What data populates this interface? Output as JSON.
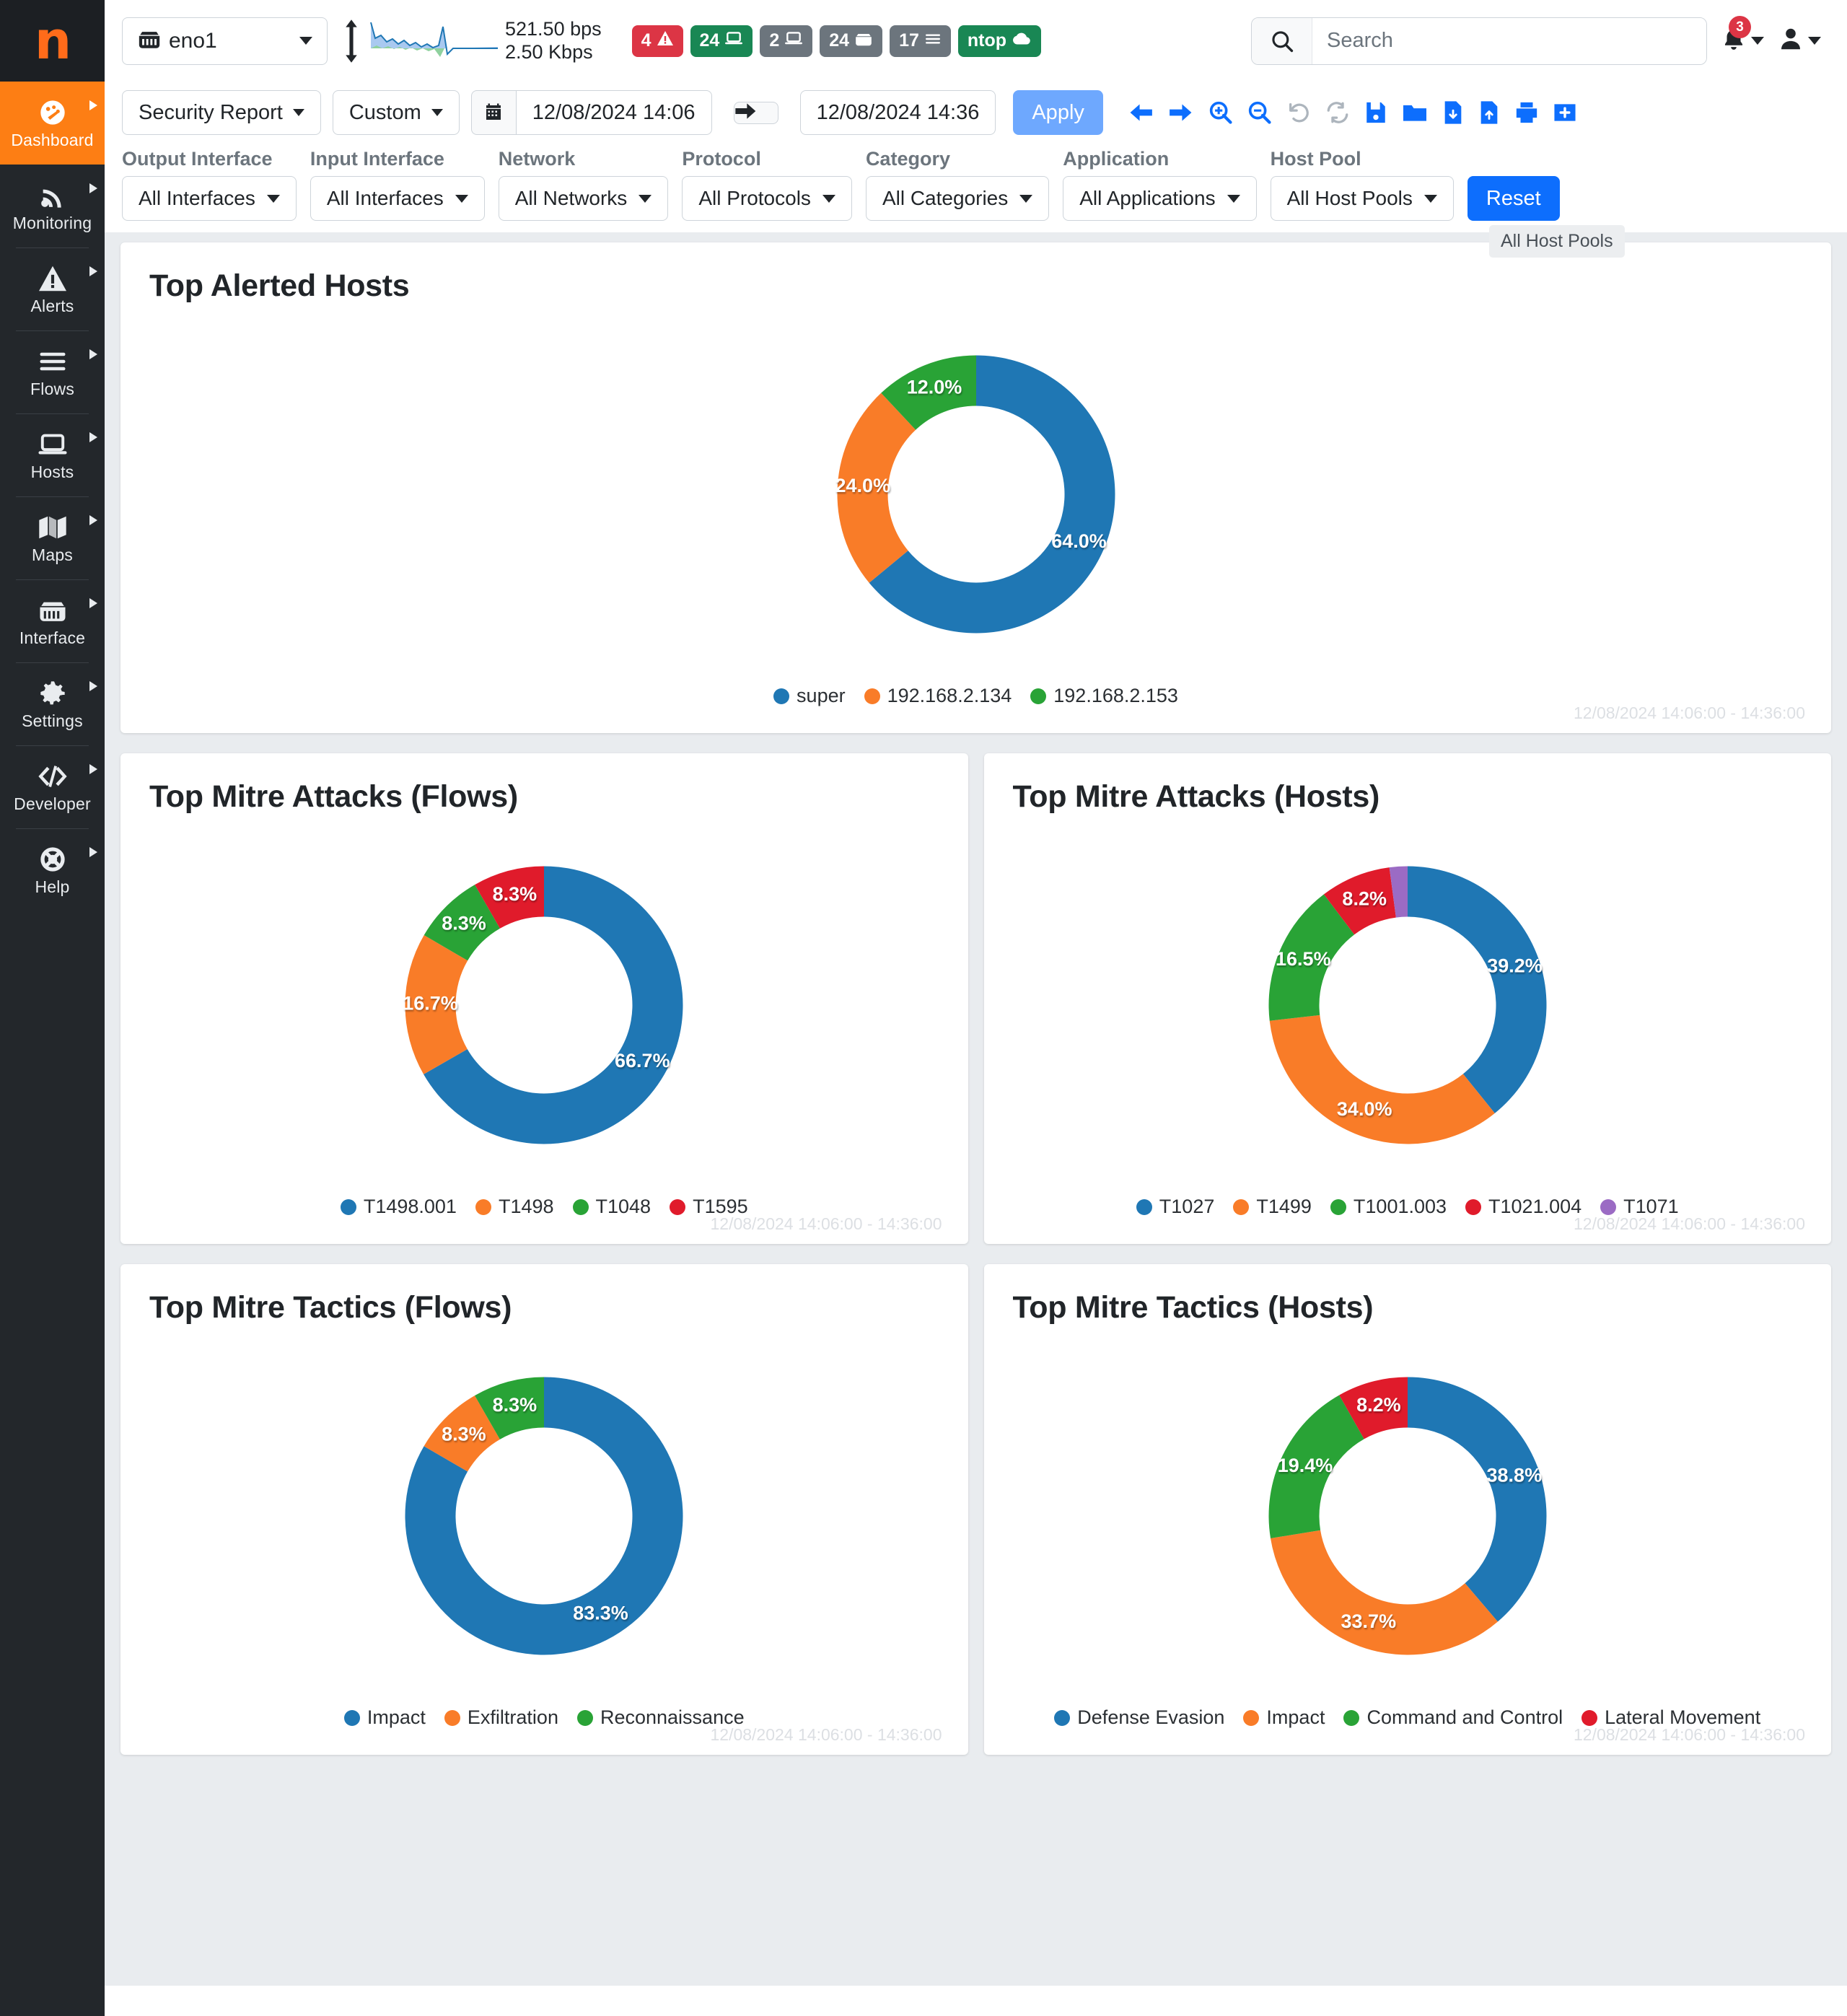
{
  "sidebar": {
    "logo": "n",
    "items": [
      {
        "label": "Dashboard",
        "icon": "dashboard-icon",
        "active": true
      },
      {
        "label": "Monitoring",
        "icon": "monitoring-icon",
        "active": false
      },
      {
        "label": "Alerts",
        "icon": "alerts-icon",
        "active": false
      },
      {
        "label": "Flows",
        "icon": "flows-icon",
        "active": false
      },
      {
        "label": "Hosts",
        "icon": "hosts-icon",
        "active": false
      },
      {
        "label": "Maps",
        "icon": "maps-icon",
        "active": false
      },
      {
        "label": "Interface",
        "icon": "interface-icon",
        "active": false
      },
      {
        "label": "Settings",
        "icon": "settings-icon",
        "active": false
      },
      {
        "label": "Developer",
        "icon": "developer-icon",
        "active": false
      },
      {
        "label": "Help",
        "icon": "help-icon",
        "active": false
      }
    ]
  },
  "topbar": {
    "interface": "eno1",
    "rate_up": "521.50 bps",
    "rate_down": "2.50 Kbps",
    "badges": [
      {
        "value": "4",
        "icon": "warning-icon",
        "color": "red"
      },
      {
        "value": "24",
        "icon": "device-icon",
        "color": "green"
      },
      {
        "value": "2",
        "icon": "device-icon",
        "color": "gray"
      },
      {
        "value": "24",
        "icon": "interface-icon",
        "color": "gray"
      },
      {
        "value": "17",
        "icon": "list-icon",
        "color": "gray"
      },
      {
        "value": "ntop",
        "icon": "cloud-icon",
        "color": "green"
      }
    ],
    "search_placeholder": "Search",
    "search_value": "",
    "notification_count": "3"
  },
  "toolbar": {
    "report": "Security Report",
    "range_preset": "Custom",
    "date_from": "12/08/2024 14:06",
    "date_to": "12/08/2024 14:36",
    "apply_label": "Apply",
    "icons": [
      "arrow-left-icon",
      "arrow-right-icon",
      "zoom-in-icon",
      "zoom-out-icon",
      "undo-icon",
      "refresh-icon",
      "save-icon",
      "open-folder-icon",
      "download-icon",
      "upload-icon",
      "print-icon",
      "add-icon"
    ]
  },
  "filters": {
    "items": [
      {
        "label": "Output Interface",
        "value": "All Interfaces"
      },
      {
        "label": "Input Interface",
        "value": "All Interfaces"
      },
      {
        "label": "Network",
        "value": "All Networks"
      },
      {
        "label": "Protocol",
        "value": "All Protocols"
      },
      {
        "label": "Category",
        "value": "All Categories"
      },
      {
        "label": "Application",
        "value": "All Applications"
      },
      {
        "label": "Host Pool",
        "value": "All Host Pools"
      }
    ],
    "reset_label": "Reset",
    "tooltip": "All Host Pools"
  },
  "timestamp_footer": "12/08/2024 14:06:00 - 14:36:00",
  "palette": {
    "blue": "#1f77b4",
    "orange": "#f97c28",
    "green": "#29a336",
    "red": "#e01b2b",
    "purple": "#9b6bc4",
    "accent": "#fd7e14",
    "primary": "#0d6efd"
  },
  "chart_data": [
    {
      "id": "top-alerted-hosts",
      "type": "pie",
      "title": "Top Alerted Hosts",
      "categories": [
        "super",
        "192.168.2.134",
        "192.168.2.153"
      ],
      "values": [
        64.0,
        24.0,
        12.0
      ],
      "labels": [
        "64.0%",
        "24.0%",
        "12.0%"
      ],
      "colors": [
        "#1f77b4",
        "#f97c28",
        "#29a336"
      ],
      "legend_position": "bottom",
      "footer": "12/08/2024 14:06:00 - 14:36:00"
    },
    {
      "id": "top-mitre-attacks-flows",
      "type": "pie",
      "title": "Top Mitre Attacks (Flows)",
      "categories": [
        "T1498.001",
        "T1498",
        "T1048",
        "T1595"
      ],
      "values": [
        66.7,
        16.7,
        8.3,
        8.3
      ],
      "labels": [
        "66.7%",
        "16.7%",
        "8.3%",
        "8.3%"
      ],
      "colors": [
        "#1f77b4",
        "#f97c28",
        "#29a336",
        "#e01b2b"
      ],
      "legend_position": "bottom",
      "footer": "12/08/2024 14:06:00 - 14:36:00"
    },
    {
      "id": "top-mitre-attacks-hosts",
      "type": "pie",
      "title": "Top Mitre Attacks (Hosts)",
      "categories": [
        "T1027",
        "T1499",
        "T1001.003",
        "T1021.004",
        "T1071"
      ],
      "values": [
        39.2,
        34.0,
        16.5,
        8.2,
        2.1
      ],
      "labels": [
        "39.2%",
        "34.0%",
        "16.5%",
        "8.2%",
        ""
      ],
      "colors": [
        "#1f77b4",
        "#f97c28",
        "#29a336",
        "#e01b2b",
        "#9b6bc4"
      ],
      "legend_position": "bottom",
      "footer": "12/08/2024 14:06:00 - 14:36:00"
    },
    {
      "id": "top-mitre-tactics-flows",
      "type": "pie",
      "title": "Top Mitre Tactics (Flows)",
      "categories": [
        "Impact",
        "Exfiltration",
        "Reconnaissance"
      ],
      "values": [
        83.3,
        8.3,
        8.3
      ],
      "labels": [
        "83.3%",
        "8.3%",
        "8.3%"
      ],
      "colors": [
        "#1f77b4",
        "#f97c28",
        "#29a336"
      ],
      "legend_position": "bottom",
      "footer": "12/08/2024 14:06:00 - 14:36:00"
    },
    {
      "id": "top-mitre-tactics-hosts",
      "type": "pie",
      "title": "Top Mitre Tactics (Hosts)",
      "categories": [
        "Defense Evasion",
        "Impact",
        "Command and Control",
        "Lateral Movement"
      ],
      "values": [
        38.8,
        33.7,
        19.4,
        8.2
      ],
      "labels": [
        "38.8%",
        "33.7%",
        "19.4%",
        "8.2%"
      ],
      "colors": [
        "#1f77b4",
        "#f97c28",
        "#29a336",
        "#e01b2b"
      ],
      "legend_position": "bottom",
      "footer": "12/08/2024 14:06:00 - 14:36:00"
    }
  ]
}
